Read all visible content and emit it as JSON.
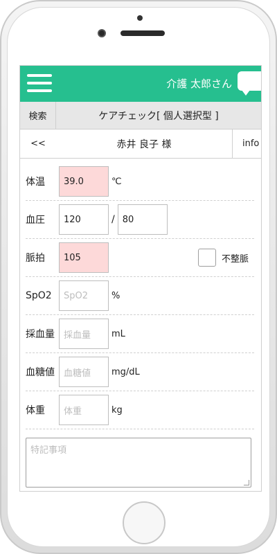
{
  "header": {
    "user_name": "介護 太郎さん"
  },
  "toolbar": {
    "search_label": "検索",
    "title": "ケアチェック[ 個人選択型 ]"
  },
  "patient_bar": {
    "back_label": "<<",
    "patient_name": "赤井 良子 様",
    "info_label": "info"
  },
  "form": {
    "temperature": {
      "label": "体温",
      "value": "39.0",
      "unit": "℃",
      "alert": true
    },
    "blood_pressure": {
      "label": "血圧",
      "systolic": "120",
      "separator": "/",
      "diastolic": "80"
    },
    "pulse": {
      "label": "脈拍",
      "value": "105",
      "alert": true,
      "irregular_label": "不整脈",
      "irregular_checked": false
    },
    "spo2": {
      "label": "SpO2",
      "placeholder": "SpO2",
      "unit": "%"
    },
    "blood_draw": {
      "label": "採血量",
      "placeholder": "採血量",
      "unit": "mL"
    },
    "blood_sugar": {
      "label": "血糖値",
      "placeholder": "血糖値",
      "unit": "mg/dL"
    },
    "weight": {
      "label": "体重",
      "placeholder": "体重",
      "unit": "kg"
    },
    "notes": {
      "placeholder": "特記事項"
    }
  },
  "colors": {
    "header": "#26bf8f",
    "alert_field": "#fdd9d9"
  }
}
